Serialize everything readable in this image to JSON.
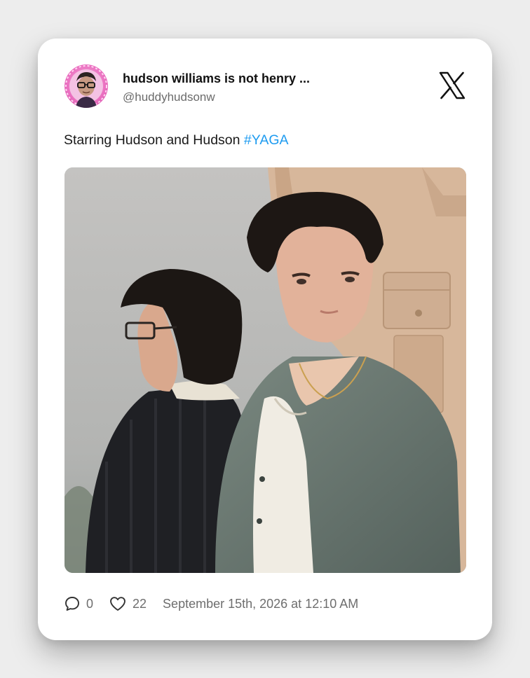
{
  "author": {
    "name": "hudson williams is not henry ...",
    "handle": "@huddyhudsonw"
  },
  "tweet": {
    "text": "Starring Hudson and Hudson ",
    "hashtag": "#YAGA"
  },
  "stats": {
    "replies": "0",
    "likes": "22",
    "timestamp": "September 15th, 2026 at 12:10 AM"
  },
  "icons": {
    "brand": "x-logo-icon",
    "reply": "speech-bubble-icon",
    "like": "heart-icon"
  },
  "colors": {
    "hashtag": "#1d9bf0",
    "avatar_ring": "#e05bb5"
  }
}
